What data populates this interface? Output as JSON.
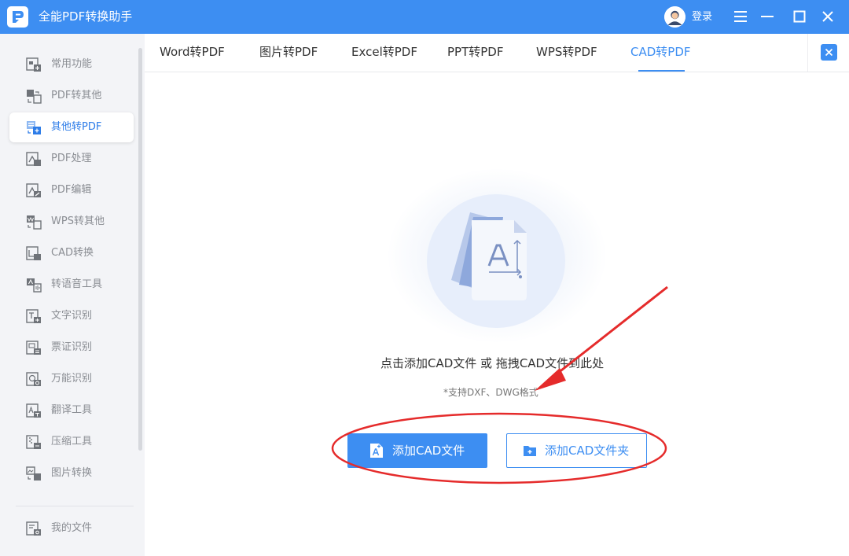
{
  "window": {
    "title": "全能PDF转换助手",
    "login_label": "登录",
    "controls": [
      "menu-icon",
      "minimize-icon",
      "maximize-icon",
      "close-icon"
    ]
  },
  "sidebar": {
    "items": [
      {
        "label": "常用功能",
        "icon": "common-functions-icon"
      },
      {
        "label": "PDF转其他",
        "icon": "pdf-to-other-icon"
      },
      {
        "label": "其他转PDF",
        "icon": "other-to-pdf-icon",
        "active": true
      },
      {
        "label": "PDF处理",
        "icon": "pdf-process-icon"
      },
      {
        "label": "PDF编辑",
        "icon": "pdf-edit-icon"
      },
      {
        "label": "WPS转其他",
        "icon": "wps-convert-icon"
      },
      {
        "label": "CAD转换",
        "icon": "cad-convert-icon"
      },
      {
        "label": "转语音工具",
        "icon": "text-to-speech-icon"
      },
      {
        "label": "文字识别",
        "icon": "text-recognition-icon"
      },
      {
        "label": "票证识别",
        "icon": "ticket-recognition-icon"
      },
      {
        "label": "万能识别",
        "icon": "universal-recognition-icon"
      },
      {
        "label": "翻译工具",
        "icon": "translate-icon"
      },
      {
        "label": "压缩工具",
        "icon": "compress-icon"
      },
      {
        "label": "图片转换",
        "icon": "image-convert-icon"
      }
    ],
    "footer_item": {
      "label": "我的文件",
      "icon": "my-files-icon"
    }
  },
  "tabs": [
    {
      "label": "Word转PDF"
    },
    {
      "label": "图片转PDF"
    },
    {
      "label": "Excel转PDF"
    },
    {
      "label": "PPT转PDF"
    },
    {
      "label": "WPS转PDF"
    },
    {
      "label": "CAD转PDF",
      "active": true
    }
  ],
  "dropzone": {
    "hint": "点击添加CAD文件 或 拖拽CAD文件到此处",
    "formats": "*支持DXF、DWG格式",
    "add_file_label": "添加CAD文件",
    "add_folder_label": "添加CAD文件夹"
  },
  "colors": {
    "accent": "#3d8ef2",
    "sidebar_bg": "#f3f4f7",
    "annotation_red": "#e52b2b"
  }
}
